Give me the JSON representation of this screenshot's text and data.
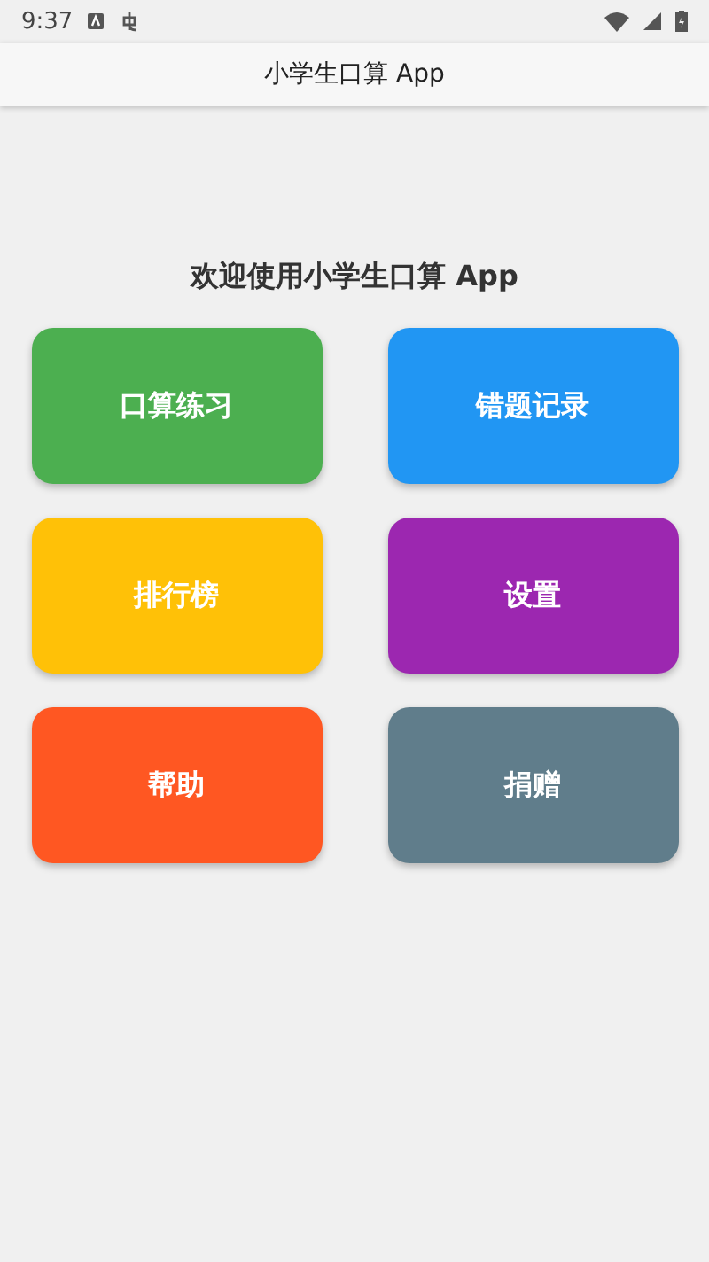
{
  "status_bar": {
    "time": "9:37"
  },
  "app_bar": {
    "title": "小学生口算 App"
  },
  "heading": "欢迎使用小学生口算 App",
  "tiles": [
    {
      "label": "口算练习",
      "color": "#4caf50"
    },
    {
      "label": "错题记录",
      "color": "#2196f3"
    },
    {
      "label": "排行榜",
      "color": "#ffc107"
    },
    {
      "label": "设置",
      "color": "#9c27b0"
    },
    {
      "label": "帮助",
      "color": "#ff5722"
    },
    {
      "label": "捐赠",
      "color": "#607d8b"
    }
  ]
}
